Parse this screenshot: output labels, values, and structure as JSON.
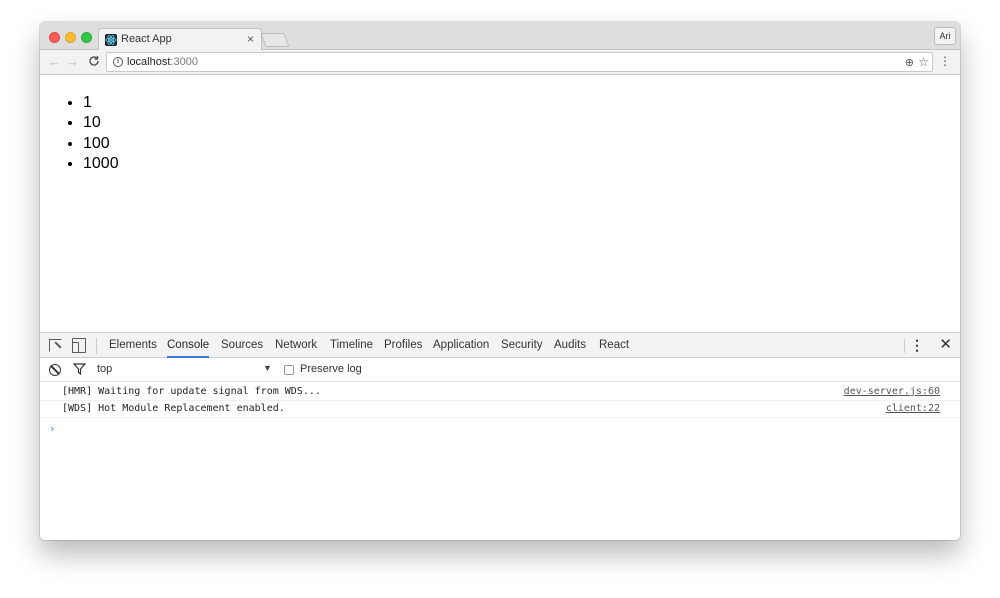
{
  "browser": {
    "tab_title": "React App",
    "tab_close": "×",
    "profile_label": "Ari",
    "url_host": "localhost",
    "url_port": ":3000"
  },
  "page": {
    "items": [
      "1",
      "10",
      "100",
      "1000"
    ]
  },
  "devtools": {
    "tabs": [
      {
        "label": "Elements",
        "active": false
      },
      {
        "label": "Console",
        "active": true
      },
      {
        "label": "Sources",
        "active": false
      },
      {
        "label": "Network",
        "active": false
      },
      {
        "label": "Timeline",
        "active": false
      },
      {
        "label": "Profiles",
        "active": false
      },
      {
        "label": "Application",
        "active": false
      },
      {
        "label": "Security",
        "active": false
      },
      {
        "label": "Audits",
        "active": false
      },
      {
        "label": "React",
        "active": false
      }
    ],
    "filter": {
      "context": "top",
      "preserve_log_label": "Preserve log",
      "preserve_log_checked": false
    },
    "messages": [
      {
        "text": "[HMR] Waiting for update signal from WDS...",
        "source": "dev-server.js:60"
      },
      {
        "text": "[WDS] Hot Module Replacement enabled.",
        "source": "client:22"
      }
    ],
    "prompt": "›"
  },
  "colors": {
    "active_tab_underline": "#3879d9",
    "prompt": "#367cf1"
  }
}
